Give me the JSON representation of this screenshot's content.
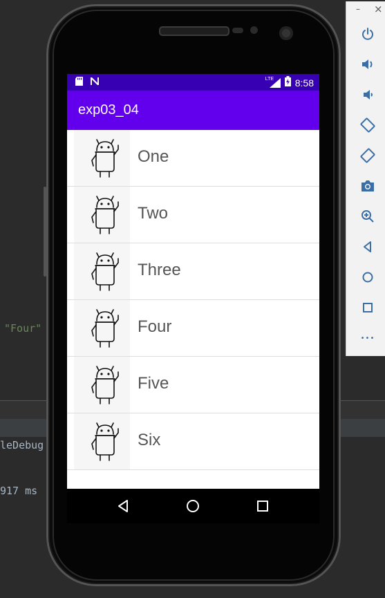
{
  "ide": {
    "code_fragment": "\"Four\"",
    "build_fragment": "leDebug",
    "time_fragment": "917 ms"
  },
  "status_bar": {
    "sd_icon": "sd-card-icon",
    "nfc_icon": "n-icon",
    "network_label": "LTE",
    "time": "8:58"
  },
  "app": {
    "title": "exp03_04"
  },
  "list": {
    "items": [
      {
        "label": "One"
      },
      {
        "label": "Two"
      },
      {
        "label": "Three"
      },
      {
        "label": "Four"
      },
      {
        "label": "Five"
      },
      {
        "label": "Six"
      }
    ]
  },
  "toolbar": {
    "minimize": "–",
    "close": "×",
    "more": "•••"
  }
}
